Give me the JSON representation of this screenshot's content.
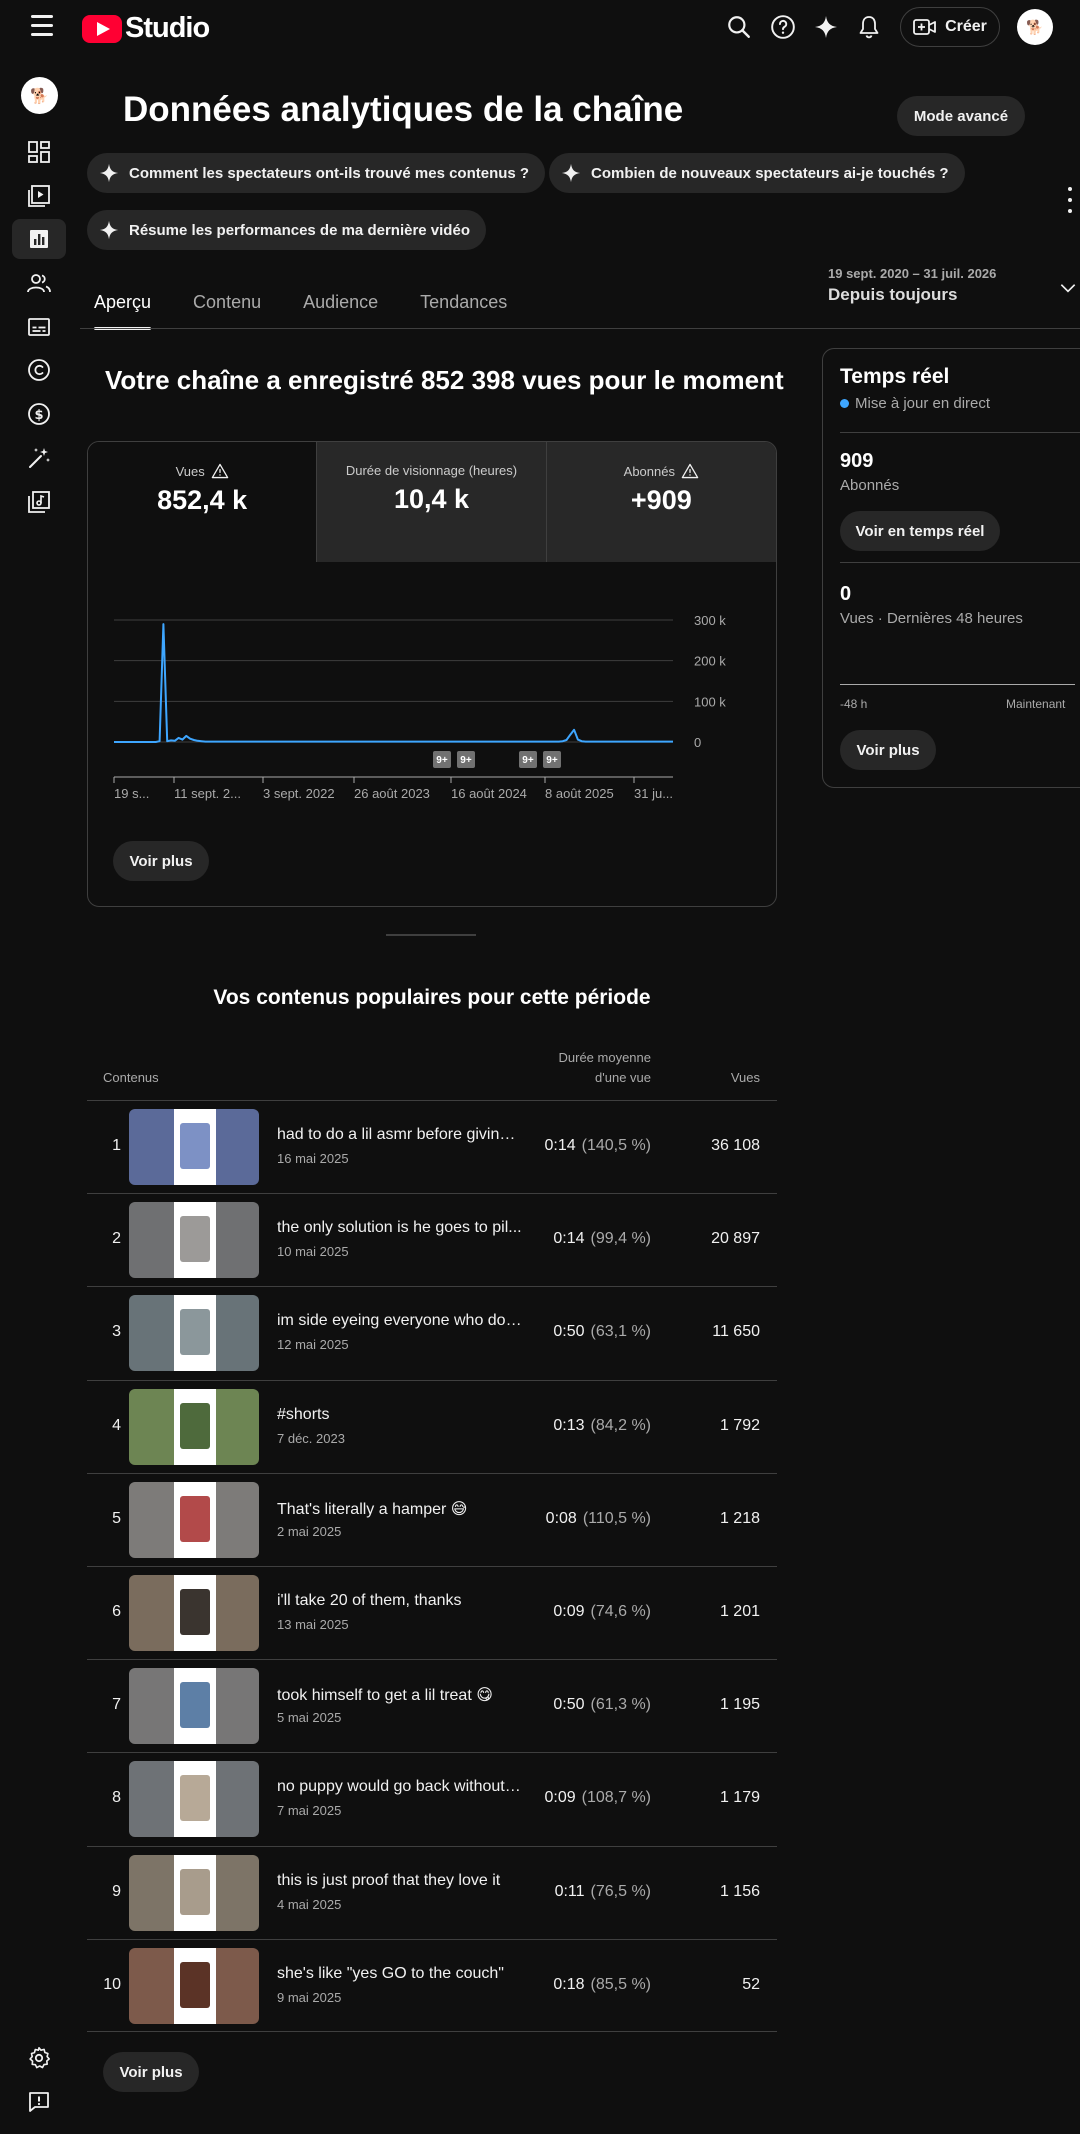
{
  "header": {
    "logo_text": "Studio",
    "create_label": "Créer"
  },
  "page": {
    "title": "Données analytiques de la chaîne",
    "advanced_mode": "Mode avancé",
    "suggestions": [
      "Comment les spectateurs ont-ils trouvé mes contenus ?",
      "Combien de nouveaux spectateurs ai-je touchés ?",
      "Résume les performances de ma dernière vidéo"
    ],
    "tabs": [
      "Aperçu",
      "Contenu",
      "Audience",
      "Tendances"
    ],
    "date_range": {
      "dates": "19 sept. 2020 – 31 juil. 2026",
      "label": "Depuis toujours"
    }
  },
  "overview": {
    "summary": "Votre chaîne a enregistré 852 398 vues pour le moment",
    "metrics": [
      {
        "label": "Vues",
        "value": "852,4 k"
      },
      {
        "label": "Durée de visionnage (heures)",
        "value": "10,4 k"
      },
      {
        "label": "Abonnés",
        "value": "+909"
      }
    ],
    "see_more": "Voir plus"
  },
  "chart_data": {
    "type": "line",
    "series": [
      {
        "values": [
          0,
          0,
          0,
          0,
          0,
          0,
          0,
          0,
          0,
          0,
          0,
          0,
          2,
          290,
          2,
          4,
          3,
          10,
          6,
          15,
          8,
          5,
          3,
          2,
          1,
          1,
          1,
          1,
          1,
          1,
          1,
          1,
          1,
          1,
          1,
          1,
          1,
          1,
          1,
          1,
          1,
          1,
          1,
          1,
          1,
          1,
          1,
          1,
          1,
          1,
          1,
          1,
          1,
          1,
          1,
          1,
          1,
          1,
          1,
          1,
          1,
          1,
          1,
          1,
          1,
          1,
          1,
          1,
          1,
          1,
          1,
          1,
          1,
          1,
          1,
          1,
          1,
          1,
          1,
          1,
          1,
          1,
          1,
          1,
          1,
          1,
          1,
          1,
          1,
          1,
          1,
          1,
          1,
          1,
          1,
          1,
          1,
          1,
          1,
          1,
          1,
          1,
          1,
          1,
          1,
          1,
          1,
          1,
          1,
          1,
          1,
          1,
          1,
          1,
          1,
          1,
          1,
          1,
          2,
          5,
          18,
          30,
          6,
          2,
          1,
          1,
          1,
          1,
          1,
          1,
          1,
          1,
          1,
          1,
          1,
          1,
          1,
          1,
          1,
          1,
          1,
          1,
          1,
          1,
          1,
          1,
          1,
          1
        ]
      }
    ],
    "x_tick_labels": [
      "19 s...",
      "11 sept. 2...",
      "3 sept. 2022",
      "26 août 2023",
      "16 août 2024",
      "8 août 2025",
      "31 ju..."
    ],
    "y_tick_labels": [
      "300 k",
      "200 k",
      "100 k",
      "0"
    ],
    "ylim": [
      0,
      300
    ],
    "markers": [
      "9+",
      "9+",
      "9+",
      "9+"
    ],
    "line_color": "#3ea6ff",
    "grid": true
  },
  "realtime": {
    "title": "Temps réel",
    "live": "Mise à jour en direct",
    "subscribers_value": "909",
    "subscribers_label": "Abonnés",
    "realtime_button": "Voir en temps réel",
    "views_value": "0",
    "views_label": "Vues · Dernières 48 heures",
    "axis_start": "-48 h",
    "axis_end": "Maintenant",
    "see_more": "Voir plus"
  },
  "top_content": {
    "title": "Vos contenus populaires pour cette période",
    "col_content": "Contenus",
    "col_duration_1": "Durée moyenne",
    "col_duration_2": "d'une vue",
    "col_views": "Vues",
    "see_more": "Voir plus",
    "rows": [
      {
        "rank": "1",
        "title": "had to do a lil asmr before giving ...",
        "date": "16 mai 2025",
        "duration": "0:14",
        "pct": "(140,5 %)",
        "views": "36 108",
        "bg": "#5b6a99",
        "fg": "#7d91c5"
      },
      {
        "rank": "2",
        "title": "the only solution is he goes to pil...",
        "date": "10 mai 2025",
        "duration": "0:14",
        "pct": "(99,4 %)",
        "views": "20 897",
        "bg": "#6f7072",
        "fg": "#9c9a98"
      },
      {
        "rank": "3",
        "title": "im side eyeing everyone who doe...",
        "date": "12 mai 2025",
        "duration": "0:50",
        "pct": "(63,1 %)",
        "views": "11 650",
        "bg": "#687378",
        "fg": "#8b979b"
      },
      {
        "rank": "4",
        "title": "#shorts",
        "date": "7 déc. 2023",
        "duration": "0:13",
        "pct": "(84,2 %)",
        "views": "1 792",
        "bg": "#6d8553",
        "fg": "#4e6a3c"
      },
      {
        "rank": "5",
        "title": "That's literally a hamper 😅",
        "date": "2 mai 2025",
        "duration": "0:08",
        "pct": "(110,5 %)",
        "views": "1 218",
        "bg": "#7d7b79",
        "fg": "#b24a4a"
      },
      {
        "rank": "6",
        "title": "i'll take 20 of them, thanks",
        "date": "13 mai 2025",
        "duration": "0:09",
        "pct": "(74,6 %)",
        "views": "1 201",
        "bg": "#7a6c5d",
        "fg": "#3a342f"
      },
      {
        "rank": "7",
        "title": "took himself to get a lil treat 😋",
        "date": "5 mai 2025",
        "duration": "0:50",
        "pct": "(61,3 %)",
        "views": "1 195",
        "bg": "#777676",
        "fg": "#5d7fa6"
      },
      {
        "rank": "8",
        "title": "no puppy would go back without ...",
        "date": "7 mai 2025",
        "duration": "0:09",
        "pct": "(108,7 %)",
        "views": "1 179",
        "bg": "#6e7276",
        "fg": "#b7a997"
      },
      {
        "rank": "9",
        "title": "this is just proof that they love it",
        "date": "4 mai 2025",
        "duration": "0:11",
        "pct": "(76,5 %)",
        "views": "1 156",
        "bg": "#7d7467",
        "fg": "#a89c8c"
      },
      {
        "rank": "10",
        "title": "she's like \"yes GO to the couch\"",
        "date": "9 mai 2025",
        "duration": "0:18",
        "pct": "(85,5 %)",
        "views": "52",
        "bg": "#7d5a4b",
        "fg": "#5b3326"
      }
    ]
  }
}
